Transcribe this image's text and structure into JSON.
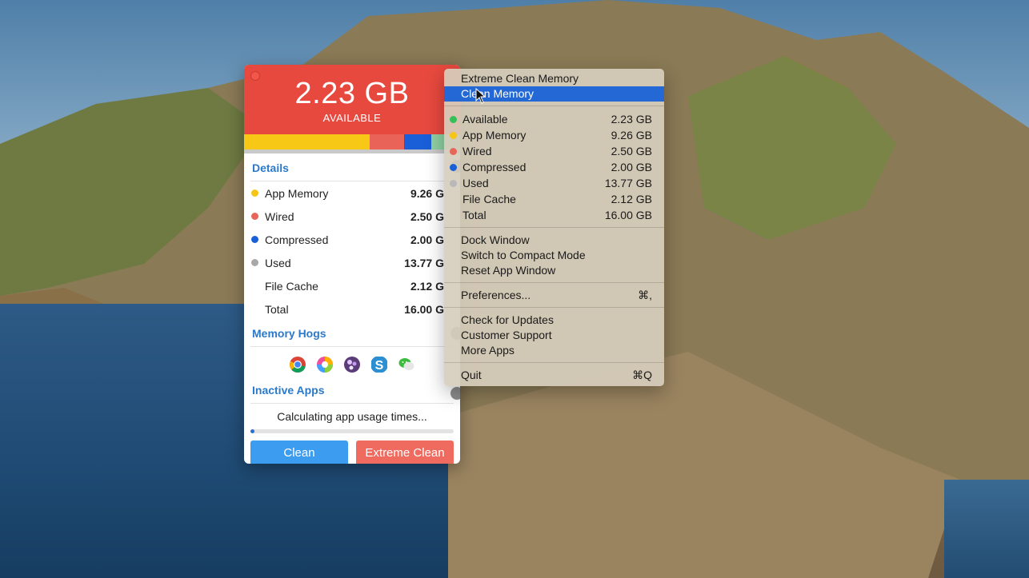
{
  "app": {
    "available_value": "2.23 GB",
    "available_label": "AVAILABLE",
    "membar_colors": [
      "#f8c817",
      "#ea6359",
      "#1a5fd8",
      "#8fd0a3"
    ],
    "details": {
      "title": "Details",
      "rows": [
        {
          "label": "App Memory",
          "value": "9.26 G",
          "color": "#f5c518"
        },
        {
          "label": "Wired",
          "value": "2.50 G",
          "color": "#e8655a"
        },
        {
          "label": "Compressed",
          "value": "2.00 G",
          "color": "#1a5fd8"
        },
        {
          "label": "Used",
          "value": "13.77 G",
          "color": "#a8a8a8"
        },
        {
          "label": "File Cache",
          "value": "2.12 G"
        },
        {
          "label": "Total",
          "value": "16.00 G"
        }
      ]
    },
    "memory_hogs": {
      "title": "Memory Hogs",
      "icons": [
        "chrome-icon",
        "color-wheel-icon",
        "photo-app-icon",
        "scrivener-icon",
        "wechat-icon"
      ]
    },
    "inactive_apps": {
      "title": "Inactive Apps",
      "status": "Calculating app usage times...",
      "progress": 0.02
    },
    "buttons": {
      "clean": "Clean",
      "extreme_clean": "Extreme Clean"
    }
  },
  "menu": {
    "actions": [
      {
        "label": "Extreme Clean Memory",
        "selected": false
      },
      {
        "label": "Clean Memory",
        "selected": true
      }
    ],
    "stats": [
      {
        "label": "Available",
        "value": "2.23 GB",
        "color": "#33c058"
      },
      {
        "label": "App Memory",
        "value": "9.26 GB",
        "color": "#f5c518"
      },
      {
        "label": "Wired",
        "value": "2.50 GB",
        "color": "#e8655a"
      },
      {
        "label": "Compressed",
        "value": "2.00 GB",
        "color": "#1a5fd8"
      },
      {
        "label": "Used",
        "value": "13.77 GB",
        "color": "#b8b8b8"
      },
      {
        "label": "File Cache",
        "value": "2.12 GB"
      },
      {
        "label": "Total",
        "value": "16.00 GB"
      }
    ],
    "window_items": [
      "Dock Window",
      "Switch to Compact Mode",
      "Reset App Window"
    ],
    "preferences": {
      "label": "Preferences...",
      "shortcut": "⌘,"
    },
    "support_items": [
      "Check for Updates",
      "Customer Support",
      "More Apps"
    ],
    "quit": {
      "label": "Quit",
      "shortcut": "⌘Q"
    }
  }
}
